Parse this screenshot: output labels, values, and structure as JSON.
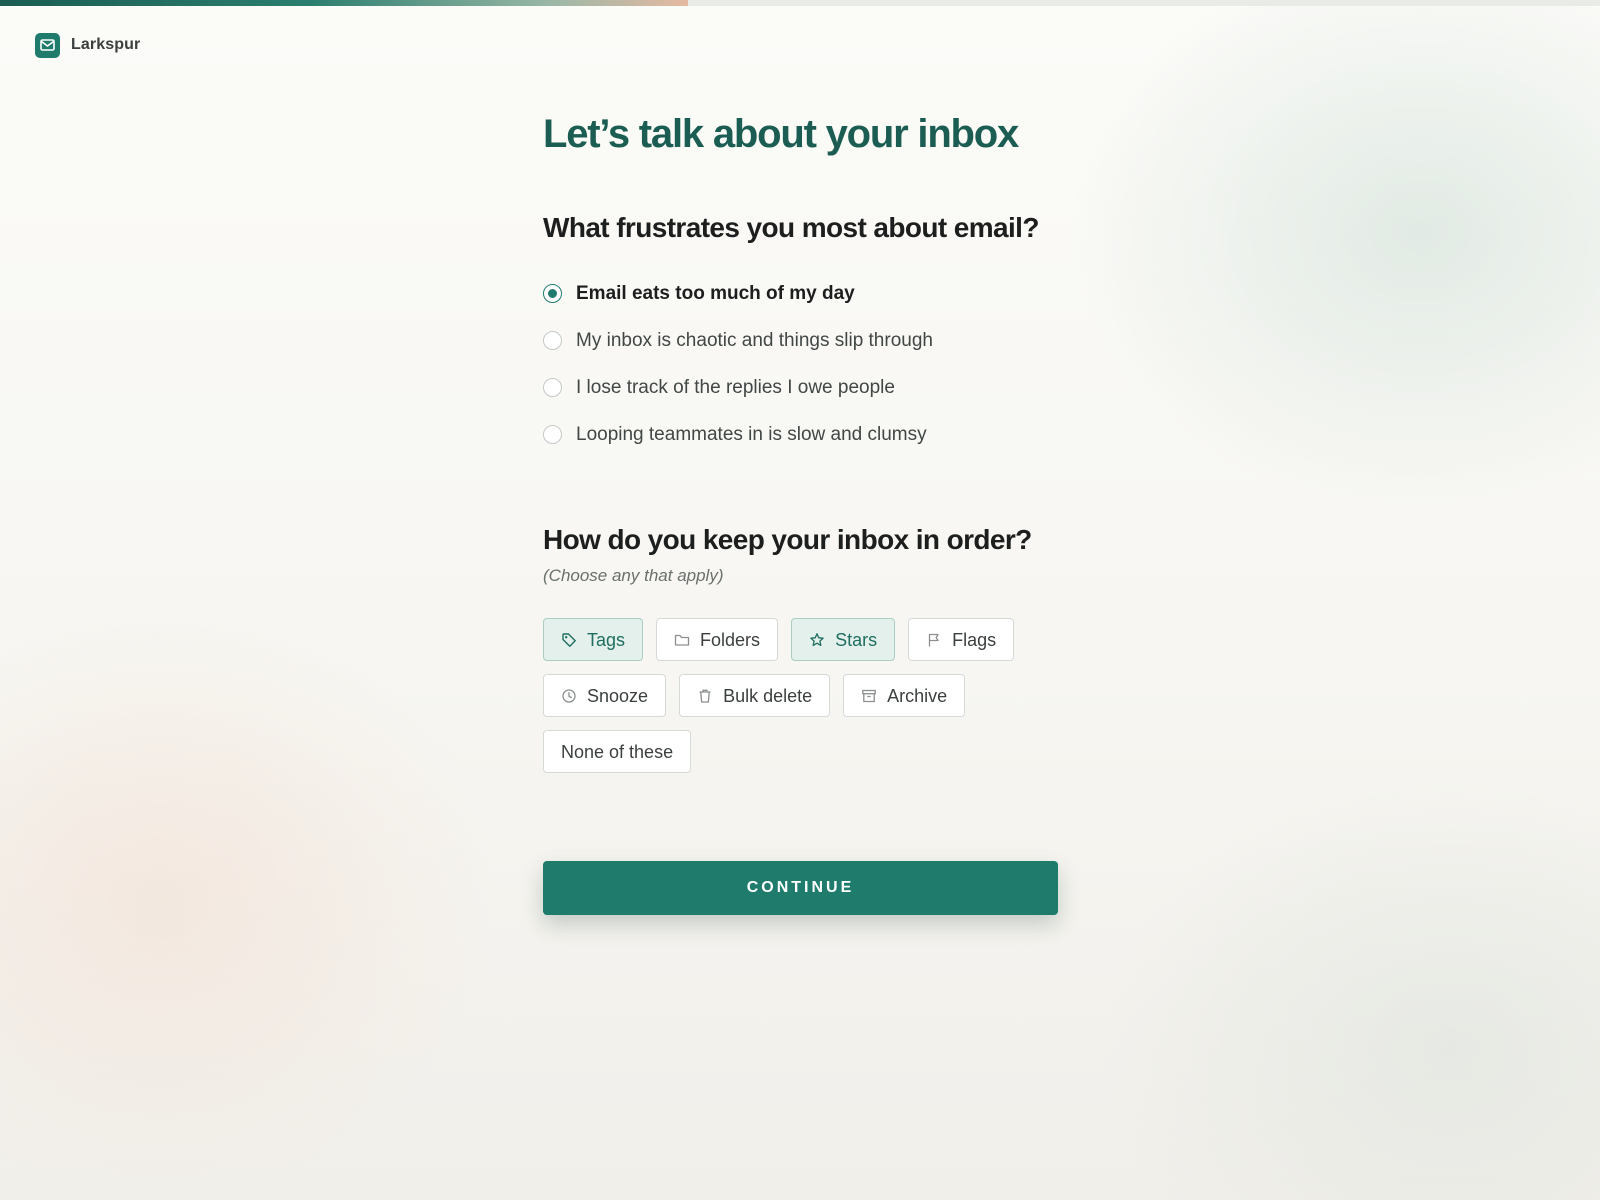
{
  "progress": {
    "fraction": 0.43
  },
  "brand": {
    "name": "Larkspur",
    "logo_icon": "mail-icon",
    "accent": "#1f7c6c"
  },
  "page_title": "Let’s talk about your inbox",
  "question1": {
    "title": "What frustrates you most about email?",
    "options": [
      {
        "label": "Email eats too much of my day",
        "selected": true
      },
      {
        "label": "My inbox is chaotic and things slip through",
        "selected": false
      },
      {
        "label": "I lose track of the replies I owe people",
        "selected": false
      },
      {
        "label": "Looping teammates in is slow and clumsy",
        "selected": false
      }
    ]
  },
  "question2": {
    "title": "How do you keep your inbox in order?",
    "hint": "(Choose any that apply)",
    "chips": [
      {
        "label": "Tags",
        "icon": "tag-icon",
        "selected": true
      },
      {
        "label": "Folders",
        "icon": "folder-icon",
        "selected": false
      },
      {
        "label": "Stars",
        "icon": "star-icon",
        "selected": true
      },
      {
        "label": "Flags",
        "icon": "flag-icon",
        "selected": false
      },
      {
        "label": "Snooze",
        "icon": "clock-icon",
        "selected": false
      },
      {
        "label": "Bulk delete",
        "icon": "trash-icon",
        "selected": false
      },
      {
        "label": "Archive",
        "icon": "archive-icon",
        "selected": false
      },
      {
        "label": "None of these",
        "icon": "",
        "selected": false
      }
    ]
  },
  "continue_label": "CONTINUE",
  "colors": {
    "accent": "#1f7c6c",
    "title": "#1b5d52",
    "chip_selected_bg": "#e3f0ec"
  }
}
